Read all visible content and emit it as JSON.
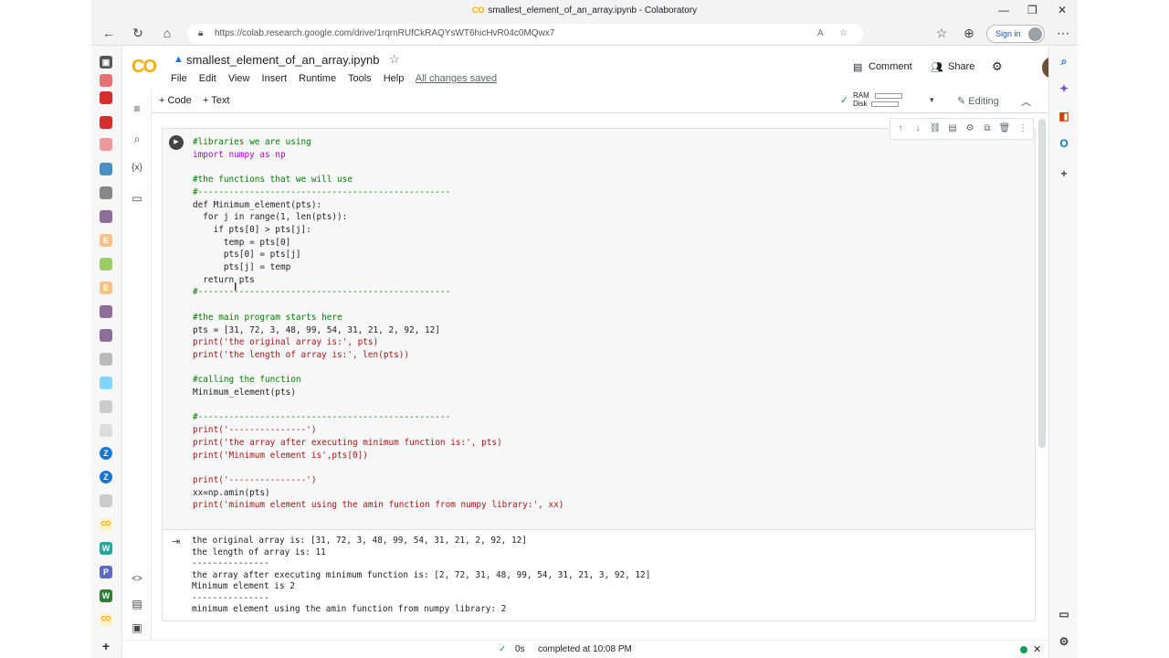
{
  "browser": {
    "window_title": "smallest_element_of_an_array.ipynb - Colaboratory",
    "url": "https://colab.research.google.com/drive/1rqrnRUfCkRAQYsWT6hicHvR04c0MQwx7",
    "sign_in": "Sign in",
    "colors": {
      "chrome": "#f3f3f3",
      "accent": "#1a56c4"
    }
  },
  "colab": {
    "logo": "CO",
    "notebook_name": "smallest_element_of_an_array.ipynb",
    "menu": [
      "File",
      "Edit",
      "View",
      "Insert",
      "Runtime",
      "Tools",
      "Help"
    ],
    "saved_status": "All changes saved",
    "comment_label": "Comment",
    "share_label": "Share",
    "add_code": "+ Code",
    "add_text": "+ Text",
    "ram_label": "RAM",
    "disk_label": "Disk",
    "editing_label": "Editing",
    "brand_color": "#f9ab00"
  },
  "cell": {
    "code_lines": [
      "#libraries we are using",
      "import numpy as np",
      "",
      "#the functions that we will use",
      "#-------------------------------------------------",
      "def Minimum_element(pts):",
      "  for j in range(1, len(pts)):",
      "    if pts[0] > pts[j]:",
      "      temp = pts[0]",
      "      pts[0] = pts[j]",
      "      pts[j] = temp",
      "  return pts",
      "#-------------------------------------------------",
      "",
      "#the main program starts here",
      "pts = [31, 72, 3, 48, 99, 54, 31, 21, 2, 92, 12]",
      "print('the original array is:', pts)",
      "print('the length of array is:', len(pts))",
      "",
      "#calling the function",
      "Minimum_element(pts)",
      "",
      "#-------------------------------------------------",
      "print('---------------')",
      "print('the array after executing minimum function is:', pts)",
      "print('Minimum element is',pts[0])",
      "",
      "print('---------------')",
      "xx=np.amin(pts)",
      "print('minimum element using the amin function from numpy library:', xx)"
    ],
    "output_lines": [
      "the original array is: [31, 72, 3, 48, 99, 54, 31, 21, 2, 92, 12]",
      "the length of array is: 11",
      "---------------",
      "the array after executing minimum function is: [2, 72, 31, 48, 99, 54, 31, 21, 3, 92, 12]",
      "Minimum element is 2",
      "---------------",
      "minimum element using the amin function from numpy library: 2"
    ]
  },
  "status": {
    "duration": "0s",
    "completed": "completed at 10:08 PM"
  }
}
